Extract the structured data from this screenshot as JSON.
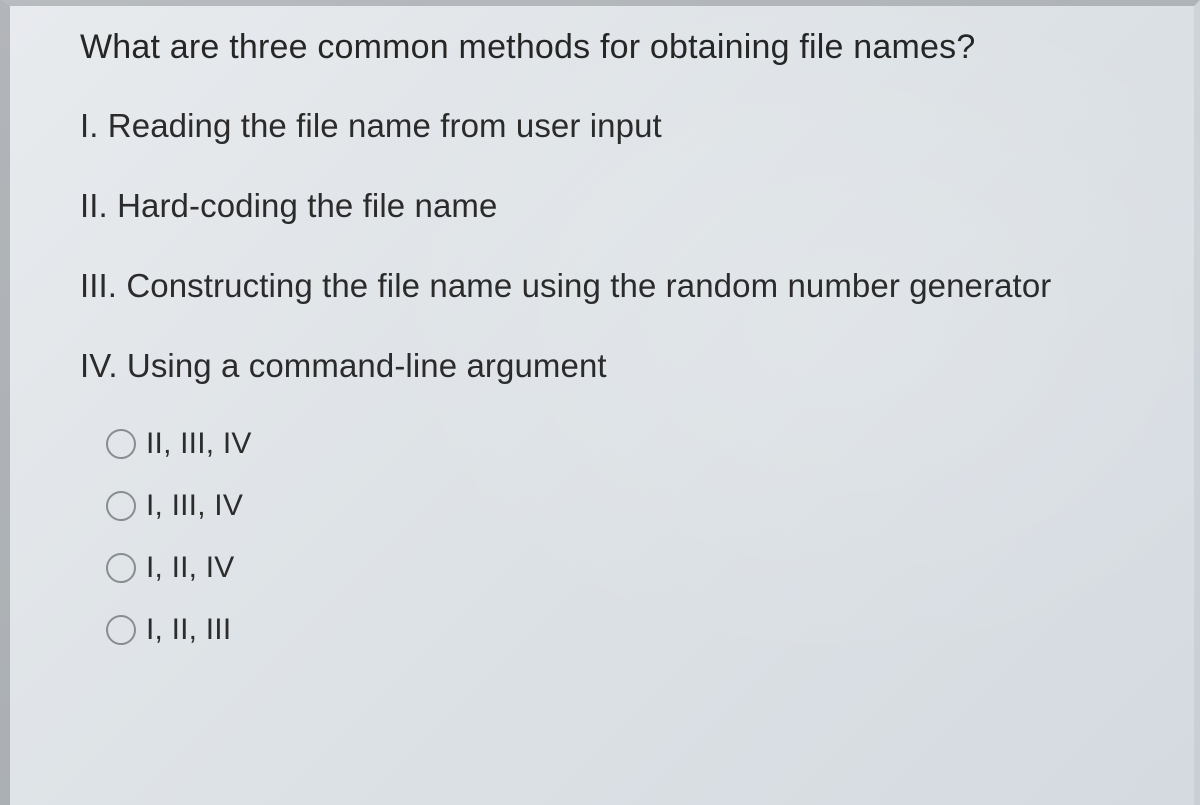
{
  "question": "What are three common methods for obtaining file names?",
  "statements": {
    "s1": "I. Reading the file name from user input",
    "s2": "II. Hard-coding the file name",
    "s3": "III. Constructing the file name using the random number generator",
    "s4": "IV. Using a command-line argument"
  },
  "options": {
    "a": "II, III, IV",
    "b": "I, III, IV",
    "c": "I, II, IV",
    "d": "I, II, III"
  }
}
